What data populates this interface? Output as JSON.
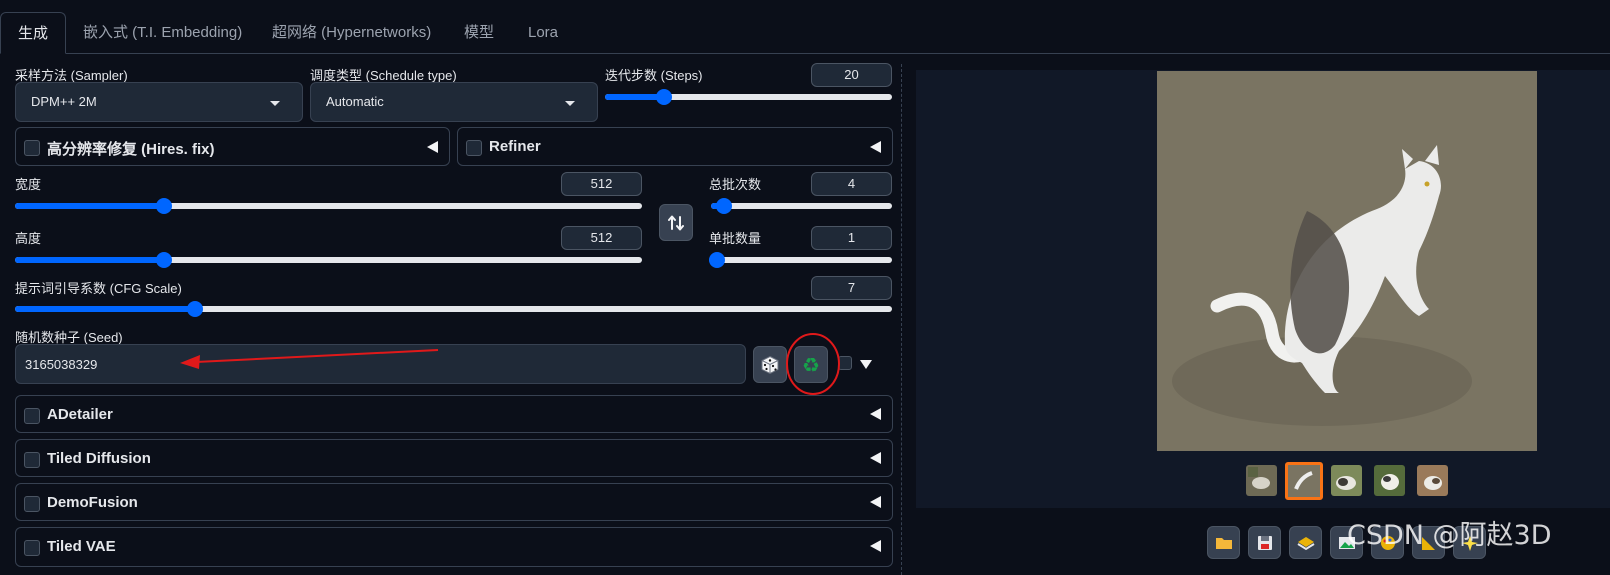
{
  "tabs": [
    "生成",
    "嵌入式 (T.I. Embedding)",
    "超网络 (Hypernetworks)",
    "模型",
    "Lora"
  ],
  "sampler": {
    "label": "采样方法 (Sampler)",
    "value": "DPM++ 2M"
  },
  "schedule": {
    "label": "调度类型 (Schedule type)",
    "value": "Automatic"
  },
  "steps": {
    "label": "迭代步数 (Steps)",
    "value": "20",
    "fraction": 0.19
  },
  "hires": {
    "label": "高分辨率修复 (Hires. fix)"
  },
  "refiner": {
    "label": "Refiner"
  },
  "width": {
    "label": "宽度",
    "value": "512",
    "fraction": 0.23
  },
  "height": {
    "label": "高度",
    "value": "512",
    "fraction": 0.23
  },
  "batch_count": {
    "label": "总批次数",
    "value": "4",
    "fraction": 0.03
  },
  "batch_size": {
    "label": "单批数量",
    "value": "1",
    "fraction": 0.0
  },
  "cfg": {
    "label": "提示词引导系数 (CFG Scale)",
    "value": "7",
    "fraction": 0.2
  },
  "seed": {
    "label": "随机数种子 (Seed)",
    "value": "3165038329"
  },
  "accordions": [
    "ADetailer",
    "Tiled Diffusion",
    "DemoFusion",
    "Tiled VAE"
  ],
  "watermark": "CSDN @阿赵3D",
  "colors": {
    "accent": "#0066ff",
    "annotation": "#e0191a",
    "selected_thumb": "#f97316",
    "recycle": "#16a34a"
  },
  "icons": {
    "swap": "swap-dimensions-icon",
    "dice": "dice-icon",
    "recycle": "recycle-icon",
    "toolbar": [
      "folder-icon",
      "save-icon",
      "zip-icon",
      "image-icon",
      "palette-icon",
      "ruler-icon",
      "sparkle-icon"
    ]
  }
}
